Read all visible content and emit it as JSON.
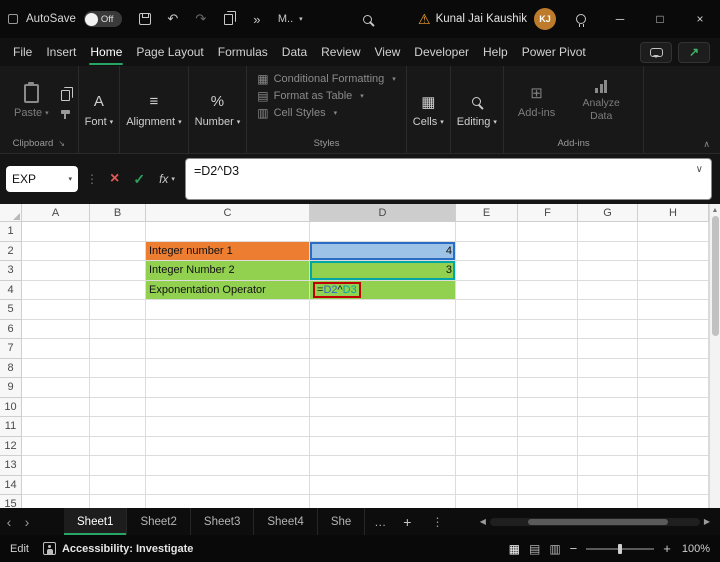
{
  "titlebar": {
    "autosave_label": "AutoSave",
    "autosave_state": "Off",
    "quick_access": "M..",
    "user_name": "Kunal Jai Kaushik",
    "user_initials": "KJ"
  },
  "menubar": {
    "items": [
      "File",
      "Insert",
      "Home",
      "Page Layout",
      "Formulas",
      "Data",
      "Review",
      "View",
      "Developer",
      "Help",
      "Power Pivot"
    ],
    "active_item": "Home"
  },
  "ribbon": {
    "paste": "Paste",
    "clipboard_group": "Clipboard",
    "font": "Font",
    "alignment": "Alignment",
    "number": "Number",
    "conditional_formatting": "Conditional Formatting",
    "format_as_table": "Format as Table",
    "cell_styles": "Cell Styles",
    "styles_group": "Styles",
    "cells": "Cells",
    "editing": "Editing",
    "addins": "Add-ins",
    "analyze_data": "Analyze Data",
    "addins_group": "Add-ins"
  },
  "formula_bar": {
    "name_box": "EXP",
    "fx": "fx",
    "formula": "=D2^D3"
  },
  "grid": {
    "column_headers": [
      "A",
      "B",
      "C",
      "D",
      "E",
      "F",
      "G",
      "H"
    ],
    "selected_column": "D",
    "row_count": 15,
    "cells": {
      "C2": {
        "text": "Integer number 1",
        "bg": "#ED7D31"
      },
      "D2": {
        "text": "4",
        "bg": "#9DC3E6",
        "align": "right",
        "ref_border": "#2B6CC4"
      },
      "C3": {
        "text": "Integer Number 2",
        "bg": "#92D050"
      },
      "D3": {
        "text": "3",
        "bg": "#92D050",
        "align": "right",
        "ref_border": "#00A6A6"
      },
      "C4": {
        "text": "Exponentation Operator",
        "bg": "#92D050"
      },
      "D4": {
        "bg": "#92D050",
        "box_color": "#C00000",
        "parts": [
          {
            "text": "=",
            "color": "#1a1a1a"
          },
          {
            "text": "D2",
            "color": "#2B6CC4"
          },
          {
            "text": "^",
            "color": "#1a1a1a"
          },
          {
            "text": "D3",
            "color": "#00A6A6"
          }
        ]
      }
    }
  },
  "sheet_tabs": {
    "tabs": [
      "Sheet1",
      "Sheet2",
      "Sheet3",
      "Sheet4",
      "She"
    ],
    "active_tab": "Sheet1"
  },
  "status_bar": {
    "mode": "Edit",
    "accessibility": "Accessibility: Investigate",
    "zoom": "100%"
  },
  "colors": {
    "accent_green": "#27A567",
    "orange_fill": "#ED7D31",
    "green_fill": "#92D050",
    "blue_fill": "#9DC3E6",
    "red_box": "#C00000"
  }
}
